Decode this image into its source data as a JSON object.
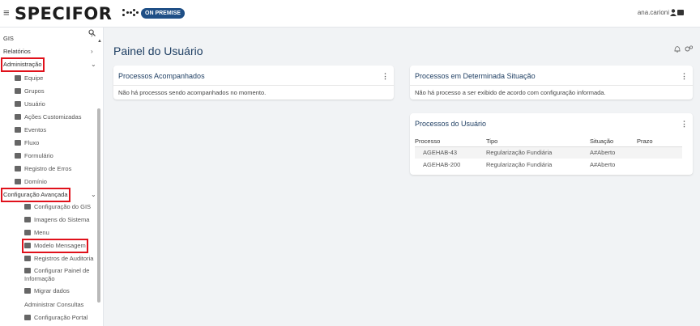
{
  "header": {
    "brand": "SPECIFOR",
    "badge": "ON PREMISE",
    "user": "ana.carioni"
  },
  "sidebar": {
    "items": [
      {
        "label": "GIS"
      },
      {
        "label": "Relatórios"
      },
      {
        "label": "Administração"
      }
    ],
    "admin_items": [
      {
        "label": "Equipe"
      },
      {
        "label": "Grupos"
      },
      {
        "label": "Usuário"
      },
      {
        "label": "Ações Customizadas"
      },
      {
        "label": "Eventos"
      },
      {
        "label": "Fluxo"
      },
      {
        "label": "Formulário"
      },
      {
        "label": "Registro de Erros"
      },
      {
        "label": "Domínio"
      }
    ],
    "config_title": "Configuração Avançada",
    "config_items": [
      {
        "label": "Configuração do GIS"
      },
      {
        "label": "Imagens do Sistema"
      },
      {
        "label": "Menu"
      },
      {
        "label": "Modelo Mensagem"
      },
      {
        "label": "Registros de Auditoria"
      },
      {
        "label": "Configurar Painel de Informação"
      },
      {
        "label": "Migrar dados"
      },
      {
        "label": "Administrar Consultas"
      },
      {
        "label": "Configuração Portal"
      }
    ]
  },
  "main": {
    "title": "Painel do Usuário",
    "card1": {
      "title": "Processos Acompanhados",
      "message": "Não há processos sendo acompanhados no momento."
    },
    "card2": {
      "title": "Processos em Determinada Situação",
      "message": "Não há processo a ser exibido de acordo com configuração informada."
    },
    "card3": {
      "title": "Processos do Usuário",
      "columns": [
        "Processo",
        "Tipo",
        "Situação",
        "Prazo"
      ],
      "rows": [
        [
          "AGEHAB-43",
          "Regularização Fundiária",
          "A#Aberto",
          ""
        ],
        [
          "AGEHAB-200",
          "Regularização Fundiária",
          "A#Aberto",
          ""
        ]
      ]
    }
  }
}
